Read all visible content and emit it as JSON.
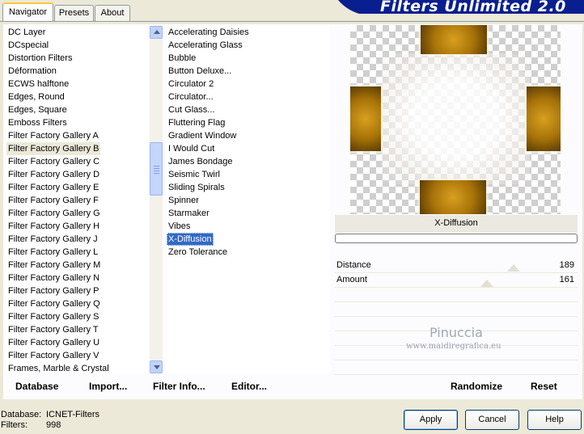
{
  "window": {
    "title": "Filters Unlimited 2.0"
  },
  "tabs": [
    {
      "label": "Navigator",
      "active": true
    },
    {
      "label": "Presets",
      "active": false
    },
    {
      "label": "About",
      "active": false
    }
  ],
  "categories": {
    "items": [
      "DC Layer",
      "DCspecial",
      "Distortion Filters",
      "Déformation",
      "ECWS halftone",
      "Edges, Round",
      "Edges, Square",
      "Emboss Filters",
      "Filter Factory Gallery A",
      "Filter Factory Gallery B",
      "Filter Factory Gallery C",
      "Filter Factory Gallery D",
      "Filter Factory Gallery E",
      "Filter Factory Gallery F",
      "Filter Factory Gallery G",
      "Filter Factory Gallery H",
      "Filter Factory Gallery J",
      "Filter Factory Gallery L",
      "Filter Factory Gallery M",
      "Filter Factory Gallery N",
      "Filter Factory Gallery P",
      "Filter Factory Gallery Q",
      "Filter Factory Gallery S",
      "Filter Factory Gallery T",
      "Filter Factory Gallery U",
      "Filter Factory Gallery V",
      "Frames, Marble & Crystal"
    ],
    "selected": "Filter Factory Gallery B"
  },
  "filters": {
    "items": [
      "Accelerating Daisies",
      "Accelerating Glass",
      "Bubble",
      "Button Deluxe...",
      "Circulator 2",
      "Circulator...",
      "Cut Glass...",
      "Fluttering Flag",
      "Gradient Window",
      "I Would Cut",
      "James Bondage",
      "Seismic Twirl",
      "Sliding Spirals",
      "Spinner",
      "Starmaker",
      "Vibes",
      "X-Diffusion",
      "Zero Tolerance"
    ],
    "selected": "X-Diffusion"
  },
  "preview": {
    "filter_name": "X-Diffusion"
  },
  "params": [
    {
      "label": "Distance",
      "value": "189"
    },
    {
      "label": "Amount",
      "value": "161"
    }
  ],
  "watermark": {
    "line1": "Pinuccia",
    "line2": "www.maidiregrafica.eu"
  },
  "panel_buttons": {
    "database": "Database",
    "import": "Import...",
    "filter_info": "Filter Info...",
    "editor": "Editor...",
    "randomize": "Randomize",
    "reset": "Reset"
  },
  "footer": {
    "database_label": "Database:",
    "database_value": "ICNET-Filters",
    "filters_label": "Filters:",
    "filters_value": "998"
  },
  "dialog_buttons": {
    "apply": "Apply",
    "cancel": "Cancel",
    "help": "Help"
  },
  "colors": {
    "banner": "#0a1f8f",
    "selection": "#316ac5",
    "gold": "#a87308"
  }
}
